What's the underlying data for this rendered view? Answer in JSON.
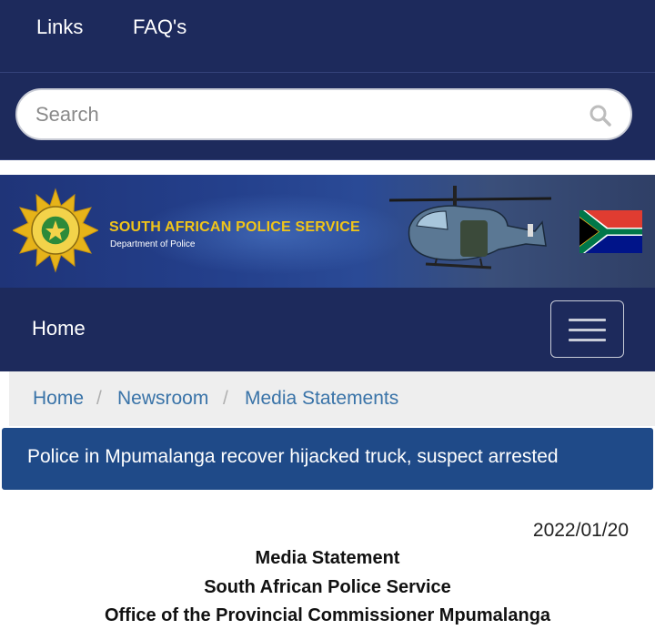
{
  "topnav": {
    "links_label": "Links",
    "faq_label": "FAQ's"
  },
  "search": {
    "placeholder": "Search"
  },
  "banner": {
    "title": "SOUTH AFRICAN POLICE SERVICE",
    "subtitle": "Department of Police",
    "badge_text": "SOUTH AFRICAN POLICE SERVICE"
  },
  "navbar": {
    "home_label": "Home"
  },
  "breadcrumb": {
    "items": [
      "Home",
      "Newsroom",
      "Media Statements"
    ]
  },
  "article": {
    "title": "Police in Mpumalanga recover hijacked truck, suspect arrested",
    "date": "2022/01/20",
    "heading_lines": [
      "Media Statement",
      "South African Police Service",
      "Office of the Provincial Commissioner Mpumalanga"
    ]
  },
  "colors": {
    "navy": "#1d2a5c",
    "title_bar": "#1f4a88",
    "link_blue": "#3973a8",
    "gold": "#f0c419"
  }
}
